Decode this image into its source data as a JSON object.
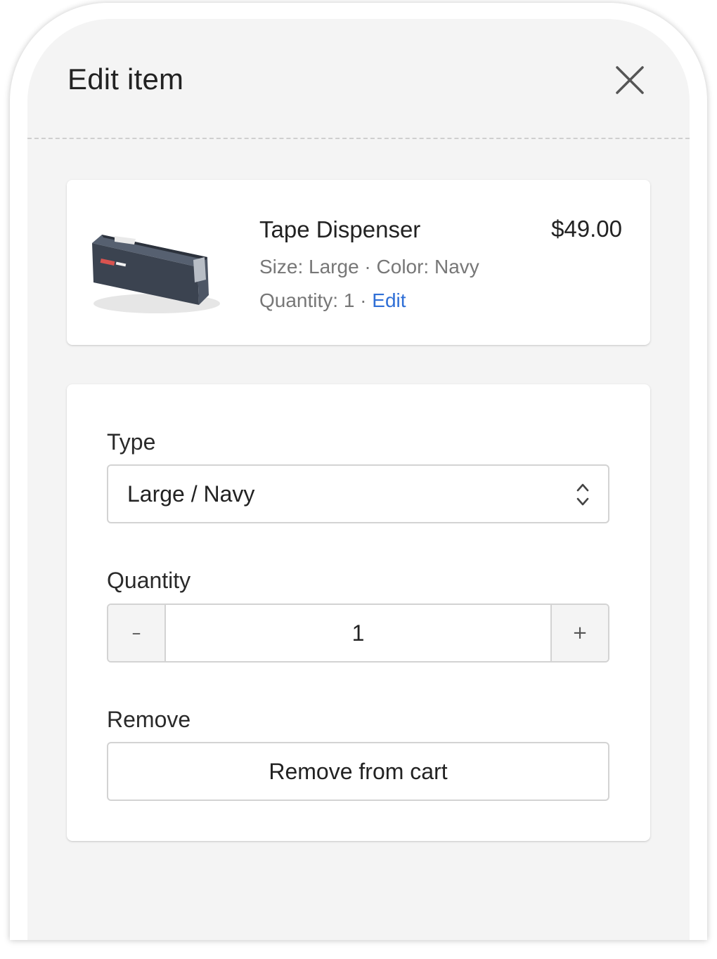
{
  "sheet": {
    "title": "Edit item",
    "close_icon": "close-icon"
  },
  "product": {
    "name": "Tape Dispenser",
    "price": "$49.00",
    "variant": "Size: Large · Color: Navy",
    "quantity_text": "Quantity: 1 · ",
    "edit_label": "Edit",
    "image_alt": "Navy tape dispenser"
  },
  "form": {
    "type_label": "Type",
    "type_value": "Large / Navy",
    "quantity_label": "Quantity",
    "quantity_value": "1",
    "decrement_symbol": "–",
    "increment_symbol": "+",
    "remove_label": "Remove",
    "remove_button": "Remove from cart"
  },
  "colors": {
    "link": "#2f6fd6",
    "sheet_bg": "#f4f4f4",
    "card_bg": "#ffffff",
    "product_navy": "#3b4350"
  }
}
